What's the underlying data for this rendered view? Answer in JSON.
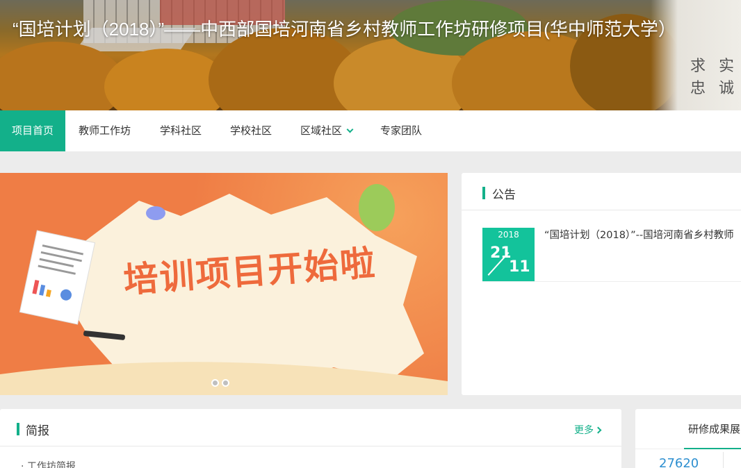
{
  "banner": {
    "title": "“国培计划（2018）”——中西部国培河南省乡村教师工作坊研修项目(华中师范大学）",
    "calligraphy_line1": "求 实",
    "calligraphy_line2": "忠 诚"
  },
  "nav": {
    "items": [
      {
        "label": "项目首页",
        "active": true
      },
      {
        "label": "教师工作坊"
      },
      {
        "label": "学科社区"
      },
      {
        "label": "学校社区"
      },
      {
        "label": "区域社区",
        "has_dropdown": true
      },
      {
        "label": "专家团队"
      }
    ]
  },
  "carousel": {
    "slide_text": "培训项目开始啦",
    "slide_count": 2,
    "active_index": 0
  },
  "notice": {
    "title": "公告",
    "items": [
      {
        "year": "2018",
        "day": "21",
        "month": "11",
        "text": "“国培计划（2018）”--国培河南省乡村教师"
      }
    ]
  },
  "brief": {
    "title": "简报",
    "more_label": "更多",
    "first_item": "· 工作坊简报"
  },
  "results": {
    "tab_label": "研修成果展",
    "stat_value": "27620"
  },
  "colors": {
    "accent": "#13b08a",
    "date_badge": "#13c39b",
    "banner_slide": "#ef7d45",
    "stat_number": "#2d8fd0"
  }
}
